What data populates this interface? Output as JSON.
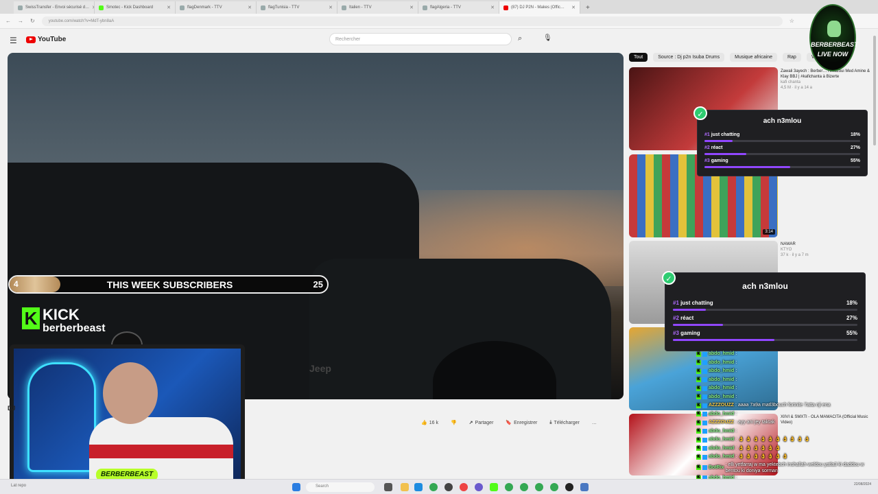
{
  "browser": {
    "tabs": [
      {
        "label": "SwissTransfer - Envoi sécurisé d…",
        "active": false
      },
      {
        "label": "Smotec - Kick Dashboard",
        "active": false
      },
      {
        "label": "flagDenmark - TTV",
        "active": false
      },
      {
        "label": "flagTunisia - TTV",
        "active": false
      },
      {
        "label": "Italien - TTV",
        "active": false
      },
      {
        "label": "flagAlgeria - TTV",
        "active": false
      },
      {
        "label": "(87) DJ P2N - Makes (Offic…",
        "active": true
      }
    ],
    "url": "youtube.com/watch?v=MdT-ybn8aA"
  },
  "youtube": {
    "logo_text": "YouTube",
    "search_placeholder": "Rechercher",
    "video_title_fragment": "DJ",
    "actions": {
      "likes": "16 k",
      "share": "Partager",
      "save": "Enregistrer",
      "download": "Télécharger",
      "more": "…"
    },
    "chips": [
      "Tout",
      "Source : Dj p2n Isuba Drums",
      "Musique africaine",
      "Rap",
      "Vidéos"
    ],
    "recommendations": [
      {
        "title": "Zawali 3ayech : Berber… Hmazoui Med Amine & Klay BBJ | #kafichanta à Bizerte",
        "channel": "kafi chanta",
        "stats": "4,5 M · il y a 14 a",
        "duration": ""
      },
      {
        "title": "",
        "channel": "",
        "stats": "",
        "duration": "3:14"
      },
      {
        "title": "NAWAR",
        "channel": "KTYO",
        "stats": "37 k · il y a 7 m",
        "duration": ""
      },
      {
        "title": "",
        "channel": "",
        "stats": "",
        "duration": ""
      },
      {
        "title": "XIIVI & SMXTI - OLA MAMACITA (Official Music Video)",
        "channel": "",
        "stats": "",
        "duration": ""
      }
    ]
  },
  "overlay": {
    "subscribers": {
      "current": "4",
      "label": "THIS WEEK SUBSCRIBERS",
      "goal": "25",
      "progress_fraction": 0.16
    },
    "kick": {
      "brand": "KICK",
      "username": "berberbeast"
    },
    "webcam_name": "BERBERBEAST",
    "badge": {
      "line1": "BERBERBEAST",
      "line2": "LIVE NOW"
    },
    "polls": [
      {
        "title": "ach n3mlou",
        "options": [
          {
            "rank": "#1",
            "label": "just chatting",
            "percent": "18%",
            "value": 18
          },
          {
            "rank": "#2",
            "label": "réact",
            "percent": "27%",
            "value": 27
          },
          {
            "rank": "#3",
            "label": "gaming",
            "percent": "55%",
            "value": 55
          }
        ]
      },
      {
        "title": "ach n3mlou",
        "options": [
          {
            "rank": "#1",
            "label": "just chatting",
            "percent": "18%",
            "value": 18
          },
          {
            "rank": "#2",
            "label": "réact",
            "percent": "27%",
            "value": 27
          },
          {
            "rank": "#3",
            "label": "gaming",
            "percent": "55%",
            "value": 55
          }
        ]
      }
    ],
    "chat": [
      {
        "user": "abdo_hmid",
        "text": ":"
      },
      {
        "user": "abdo_hmid",
        "text": ":"
      },
      {
        "user": "abdo_hmid",
        "text": ":"
      },
      {
        "user": "abdo_hmid",
        "text": ":"
      },
      {
        "user": "abdo_hmid",
        "text": ":"
      },
      {
        "user": "abdo_hmid",
        "text": ":"
      },
      {
        "user": "AZZZOUZZ",
        "text": ": aaaa 7a9a matl3bouch fortnite 7atta nji ena"
      },
      {
        "user": "abdo_hmid",
        "text": ":"
      },
      {
        "user": "AZZZOUZZ",
        "text": ": ayy ani jey taktak"
      },
      {
        "user": "abdo_hmid",
        "text": ":"
      },
      {
        "user": "abdo_hmid",
        "text": ": 👌 👌 👌 👌 👌 👌 👌 👌 👌 👌"
      },
      {
        "user": "abdo_hmid",
        "text": ": 👌 👌 👌 👌 👌 👌"
      },
      {
        "user": "abdo_hmid",
        "text": ": 👌 👌 👌 👌 👌 👌 👌"
      },
      {
        "user": "BotRix",
        "text": ": elli yetfarraj w ma yektebch inshallah weldou yatla3 ki daddou w bentou ki doniya sorman"
      },
      {
        "user": "abdo_hmid",
        "text": ":"
      },
      {
        "user": "abdo_hmid",
        "text": ": 👌 👌 👌"
      }
    ]
  },
  "taskbar": {
    "search_placeholder": "Search",
    "left_text": "Lat repo",
    "clock": "22/08/2024"
  },
  "colors": {
    "kick_green": "#53fc18",
    "poll_purple": "#9147ff",
    "yt_red": "#ff0000"
  }
}
